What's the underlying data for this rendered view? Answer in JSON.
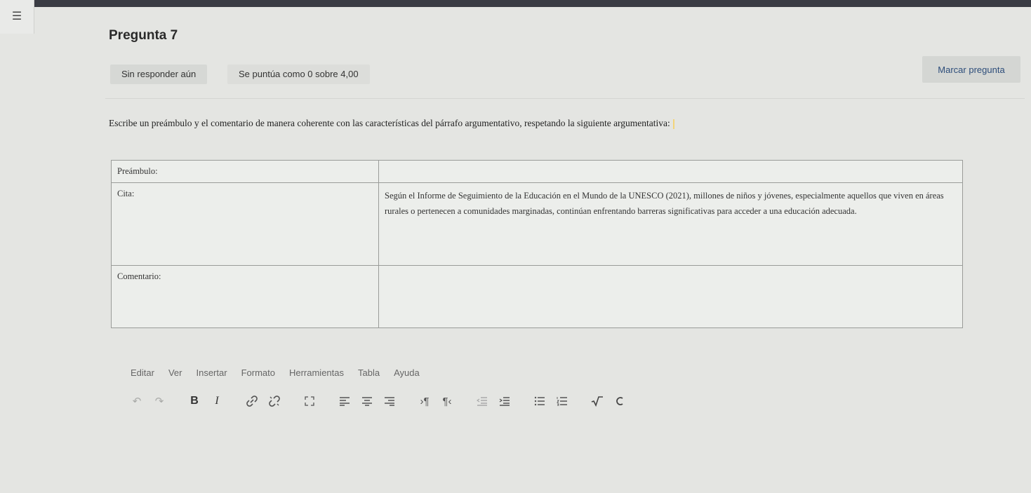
{
  "question": {
    "title": "Pregunta 7",
    "status": "Sin responder aún",
    "score": "Se puntúa como 0 sobre 4,00",
    "flag_label": "Marcar pregunta",
    "prompt": "Escribe un preámbulo y el comentario de manera coherente con las características del párrafo argumentativo, respetando la siguiente argumentativa:"
  },
  "table": {
    "rows": [
      {
        "label": "Preámbulo:",
        "content": ""
      },
      {
        "label": "Cita:",
        "content": "Según el Informe de Seguimiento de la Educación en el Mundo de la UNESCO (2021), millones de niños y jóvenes, especialmente aquellos que viven en áreas rurales o pertenecen a comunidades marginadas, continúan enfrentando barreras significativas para acceder a una educación adecuada."
      },
      {
        "label": "Comentario:",
        "content": ""
      }
    ]
  },
  "editor": {
    "menu": [
      "Editar",
      "Ver",
      "Insertar",
      "Formato",
      "Herramientas",
      "Tabla",
      "Ayuda"
    ],
    "toolbar": {
      "bold": "B",
      "italic": "I",
      "ltr": "›¶",
      "rtl": "¶‹"
    }
  },
  "icons": {
    "menu": "hamburger-icon",
    "undo": "undo-icon",
    "redo": "redo-icon",
    "link": "link-icon",
    "unlink": "unlink-icon",
    "fullscreen": "fullscreen-icon",
    "align_left": "align-left-icon",
    "align_center": "align-center-icon",
    "align_right": "align-right-icon",
    "outdent": "outdent-icon",
    "indent": "indent-icon",
    "bullet_list": "bullet-list-icon",
    "numbered_list": "numbered-list-icon",
    "equation": "equation-icon",
    "chemistry": "chemistry-icon"
  }
}
